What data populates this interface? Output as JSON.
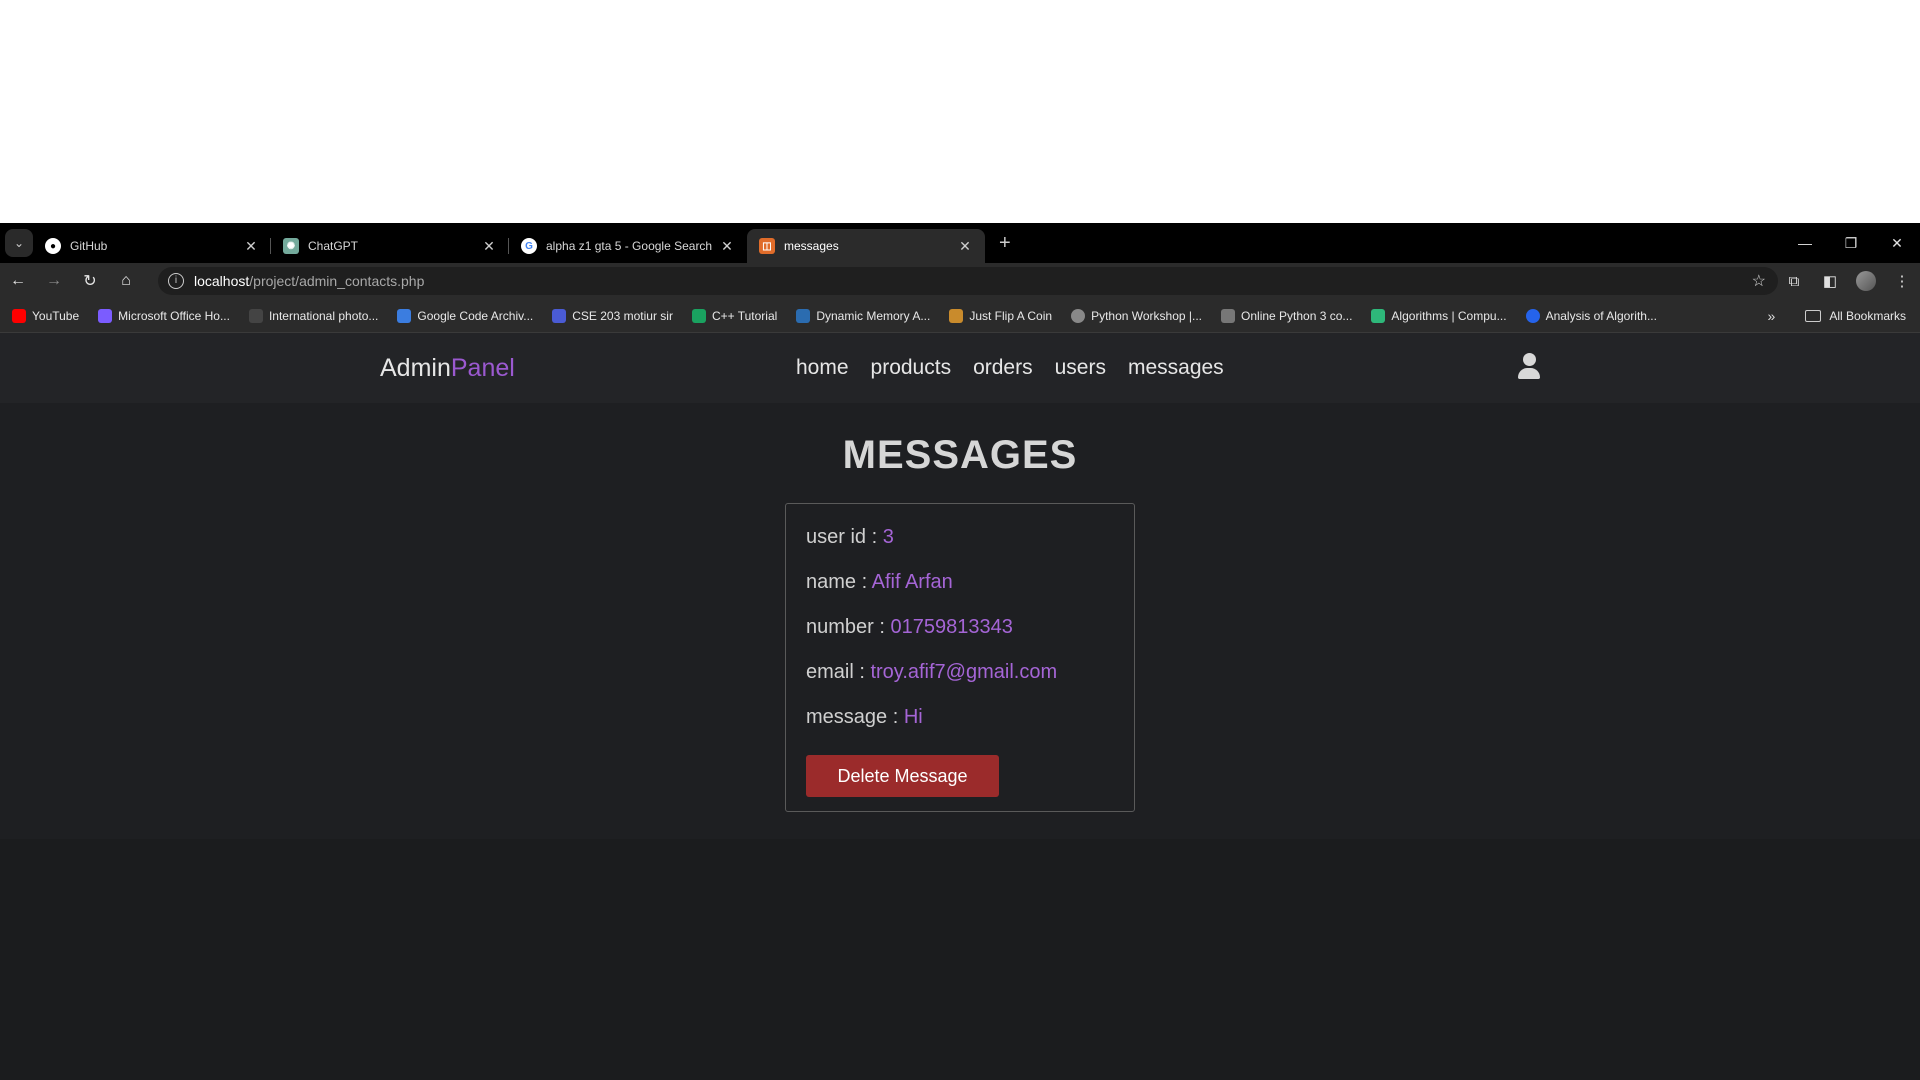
{
  "tabs": [
    {
      "title": "GitHub",
      "favicon": "github-icon",
      "active": false
    },
    {
      "title": "ChatGPT",
      "favicon": "chatgpt-icon",
      "active": false
    },
    {
      "title": "alpha z1 gta 5 - Google Search",
      "favicon": "google-icon",
      "active": false
    },
    {
      "title": "messages",
      "favicon": "page-icon",
      "active": true
    }
  ],
  "address": {
    "host": "localhost",
    "path": "/project/admin_contacts.php"
  },
  "bookmarks": [
    {
      "label": "YouTube",
      "color": "#ff0000"
    },
    {
      "label": "Microsoft Office Ho...",
      "color": "#7b5cff"
    },
    {
      "label": "International photo...",
      "color": "#444444"
    },
    {
      "label": "Google Code Archiv...",
      "color": "#3b7de0"
    },
    {
      "label": "CSE 203 motiur sir",
      "color": "#4a5bd4"
    },
    {
      "label": "C++ Tutorial",
      "color": "#1aa260"
    },
    {
      "label": "Dynamic Memory A...",
      "color": "#2b6cb0"
    },
    {
      "label": "Just Flip A Coin",
      "color": "#c98b2c"
    },
    {
      "label": "Python Workshop |...",
      "color": "#888888"
    },
    {
      "label": "Online Python 3 co...",
      "color": "#777777"
    },
    {
      "label": "Algorithms | Compu...",
      "color": "#2eb87a"
    },
    {
      "label": "Analysis of Algorith...",
      "color": "#2563eb"
    }
  ],
  "bookmarks_all": "All Bookmarks",
  "site": {
    "logo_main": "Admin",
    "logo_accent": "Panel",
    "accent_color": "#9b59d0",
    "nav": [
      "home",
      "products",
      "orders",
      "users",
      "messages"
    ]
  },
  "main": {
    "title": "MESSAGES",
    "message": {
      "user_id_label": "user id : ",
      "user_id": "3",
      "name_label": "name : ",
      "name": "Afif Arfan",
      "number_label": "number : ",
      "number": "01759813343",
      "email_label": "email : ",
      "email": "troy.afif7@gmail.com",
      "message_label": "message : ",
      "message": "Hi",
      "delete_label": "Delete Message"
    }
  }
}
